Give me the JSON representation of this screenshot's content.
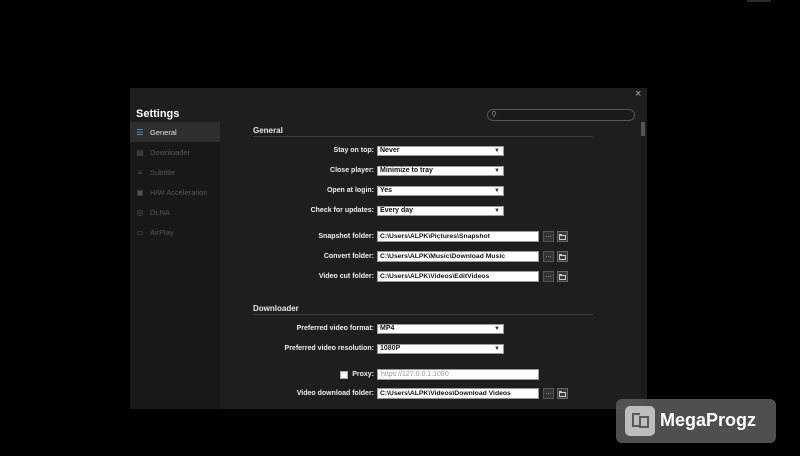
{
  "dialog": {
    "title": "Settings",
    "close_glyph": "×",
    "search_placeholder": ""
  },
  "sidebar": {
    "items": [
      {
        "label": "General",
        "icon": "☰",
        "active": true
      },
      {
        "label": "Downloader",
        "icon": "▤",
        "active": false
      },
      {
        "label": "Subtitle",
        "icon": "≡",
        "active": false
      },
      {
        "label": "H/W Acceleration",
        "icon": "▣",
        "active": false
      },
      {
        "label": "DLNA",
        "icon": "◎",
        "active": false
      },
      {
        "label": "AirPlay",
        "icon": "▭",
        "active": false
      }
    ]
  },
  "general": {
    "title": "General",
    "stay_on_top": {
      "label": "Stay on top:",
      "value": "Never"
    },
    "close_player": {
      "label": "Close player:",
      "value": "Minimize to tray"
    },
    "open_at_login": {
      "label": "Open at login:",
      "value": "Yes"
    },
    "check_updates": {
      "label": "Check for updates:",
      "value": "Every day"
    },
    "snapshot": {
      "label": "Snapshot folder:",
      "value": "C:\\Users\\ALPK\\Pictures\\Snapshot"
    },
    "convert": {
      "label": "Convert folder:",
      "value": "C:\\Users\\ALPK\\Music\\Download Music"
    },
    "videocut": {
      "label": "Video cut folder:",
      "value": "C:\\Users\\ALPK\\Videos\\EditVideos"
    }
  },
  "downloader": {
    "title": "Downloader",
    "format": {
      "label": "Preferred video format:",
      "value": "MP4"
    },
    "resolution": {
      "label": "Preferred video resolution:",
      "value": "1080P"
    },
    "proxy": {
      "label": "Proxy:",
      "placeholder": "https://127.0.0.1:1080",
      "checked": false
    },
    "download_folder": {
      "label": "Video download folder:",
      "value": "C:\\Users\\ALPK\\Videos\\Download Videos"
    }
  },
  "buttons": {
    "browse_dots": "..."
  },
  "watermark": {
    "text": "MegaProgz"
  }
}
